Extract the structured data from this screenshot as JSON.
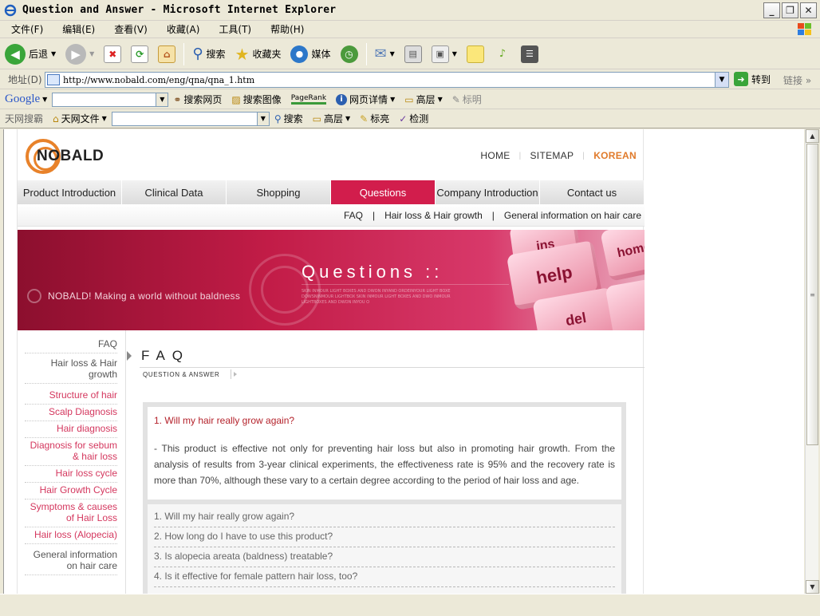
{
  "window": {
    "title": "Question and Answer - Microsoft Internet Explorer"
  },
  "menubar": {
    "items": [
      "文件(F)",
      "编辑(E)",
      "查看(V)",
      "收藏(A)",
      "工具(T)",
      "帮助(H)"
    ]
  },
  "toolbar": {
    "back_label": "后退",
    "search_label": "搜索",
    "favorites_label": "收藏夹",
    "media_label": "媒体"
  },
  "address": {
    "label": "地址(D)",
    "url": "http://www.nobald.com/eng/qna/qna_1.htm",
    "go_label": "转到",
    "links_label": "链接"
  },
  "google_bar": {
    "logo": "Google",
    "search_web": "搜索网页",
    "search_images": "搜索图像",
    "pagerank": "PageRank",
    "page_info": "网页详情",
    "highlight": "高层",
    "mark": "标明"
  },
  "tianwang_bar": {
    "label": "天网搜霸",
    "file": "天网文件",
    "search": "搜索",
    "highlight": "高层",
    "mark": "标亮",
    "detect": "检测"
  },
  "site": {
    "logo_text": "NOBALD",
    "topnav": {
      "home": "HOME",
      "sitemap": "SITEMAP",
      "korean": "KOREAN"
    },
    "mainnav": [
      "Product Introduction",
      "Clinical Data",
      "Shopping",
      "Questions",
      "Company Introduction",
      "Contact us"
    ],
    "subnav": {
      "faq": "FAQ",
      "hair_loss": "Hair loss & Hair growth",
      "general": "General information on hair care"
    },
    "banner": {
      "title": "Questions ::",
      "slogan": "NOBALD! Making a world without baldness",
      "fine_print": "SKIN INMOUR LIGHT BOXES AND DWON INYAND ORDEINYOUR LIGHT BOXE DOWSNINMOUR LIGHTBOX SKIN INMOUR LIGHT BOXES AND DWO INMOUR LIGHTBOXES AND DWON INYOU O",
      "key_1": "ins",
      "key_2": "help",
      "key_3": "home",
      "key_4": "del"
    },
    "sidebar": {
      "faq": "FAQ",
      "hair_loss_growth": "Hair loss & Hair growth",
      "structure": "Structure of hair",
      "scalp": "Scalp Diagnosis",
      "hair_diag": "Hair diagnosis",
      "sebum": "Diagnosis for sebum & hair loss",
      "cycle": "Hair loss cycle",
      "growth_cycle": "Hair Growth Cycle",
      "symptoms": "Symptoms & causes of Hair Loss",
      "alopecia": "Hair loss (Alopecia)",
      "general": "General information on hair care"
    },
    "content": {
      "heading": "FAQ",
      "label": "QUESTION & ANSWER",
      "question": "1. Will my hair really grow again?",
      "answer": "- This product is effective not only for preventing hair loss but also in promoting hair growth. From the analysis of results from 3-year clinical experiments, the effectiveness rate is 95% and the recovery rate is more than 70%, although these vary to a certain degree according to the period of hair loss and age.",
      "list": [
        "1. Will my hair really grow again?",
        "2. How long do I have to use this product?",
        "3. Is alopecia areata (baldness) treatable?",
        "4. Is it effective for female pattern hair loss, too?"
      ]
    }
  }
}
